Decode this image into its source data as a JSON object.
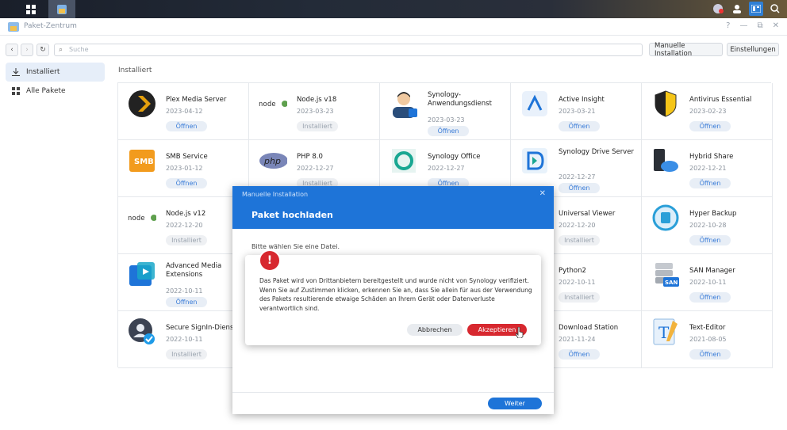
{
  "window": {
    "title": "Paket-Zentrum",
    "controls": [
      "?",
      "—",
      "⧉",
      "✕"
    ]
  },
  "toolbar": {
    "search_placeholder": "Suche",
    "manual_install": "Manuelle Installation",
    "settings": "Einstellungen"
  },
  "sidebar": {
    "items": [
      {
        "label": "Installiert",
        "icon": "download-icon",
        "active": true
      },
      {
        "label": "Alle Pakete",
        "icon": "grid-icon",
        "active": false
      }
    ]
  },
  "main": {
    "section_label": "Installiert",
    "packages": [
      {
        "name": "Plex Media Server",
        "date": "2023-04-12",
        "button": "Öffnen",
        "icon": "plex-icon"
      },
      {
        "name": "Node.js v18",
        "date": "2023-03-23",
        "button": "Installiert",
        "icon": "nodejs-icon"
      },
      {
        "name": "Synology-Anwendungsdienst",
        "date": "2023-03-23",
        "button": "Öffnen",
        "icon": "app-service-icon"
      },
      {
        "name": "Active Insight",
        "date": "2023-03-21",
        "button": "Öffnen",
        "icon": "active-insight-icon"
      },
      {
        "name": "Antivirus Essential",
        "date": "2023-02-23",
        "button": "Öffnen",
        "icon": "antivirus-icon"
      },
      {
        "name": "SMB Service",
        "date": "2023-01-12",
        "button": "Öffnen",
        "icon": "smb-icon"
      },
      {
        "name": "PHP 8.0",
        "date": "2022-12-27",
        "button": "Installiert",
        "icon": "php-icon"
      },
      {
        "name": "Synology Office",
        "date": "2022-12-27",
        "button": "Öffnen",
        "icon": "office-icon"
      },
      {
        "name": "Synology Drive Server",
        "date": "2022-12-27",
        "button": "Öffnen",
        "icon": "drive-icon"
      },
      {
        "name": "Hybrid Share",
        "date": "2022-12-21",
        "button": "Öffnen",
        "icon": "hybrid-share-icon"
      },
      {
        "name": "Node.js v12",
        "date": "2022-12-20",
        "button": "Installiert",
        "icon": "nodejs-icon"
      },
      {
        "name": "Universal Viewer",
        "date": "2022-12-20",
        "button": "Installiert",
        "icon": "viewer-icon"
      },
      {
        "name": "Hyper Backup",
        "date": "2022-10-28",
        "button": "Öffnen",
        "icon": "hyper-backup-icon"
      },
      {
        "name": "Advanced Media Extensions",
        "date": "2022-10-11",
        "button": "Öffnen",
        "icon": "media-extensions-icon"
      },
      {
        "name": "Python2",
        "date": "2022-10-11",
        "button": "Installiert",
        "icon": "python-icon"
      },
      {
        "name": "SAN Manager",
        "date": "2022-10-11",
        "button": "Öffnen",
        "icon": "san-icon"
      },
      {
        "name": "Secure SignIn-Diens",
        "date": "2022-10-11",
        "button": "Installiert",
        "icon": "secure-signin-icon"
      },
      {
        "name": "Download Station",
        "date": "2021-11-24",
        "button": "Öffnen",
        "icon": "download-station-icon"
      },
      {
        "name": "Text-Editor",
        "date": "2021-08-05",
        "button": "Öffnen",
        "icon": "text-editor-icon"
      }
    ]
  },
  "modal": {
    "small_title": "Manuelle Installation",
    "heading": "Paket hochladen",
    "prompt": "Bitte wählen Sie eine Datei.",
    "next": "Weiter"
  },
  "alert": {
    "message": "Das Paket wird von Drittanbietern bereitgestellt und wurde nicht von Synology verifiziert. Wenn Sie auf Zustimmen klicken, erkennen Sie an, dass Sie allein für aus der Verwendung des Pakets resultierende etwaige Schäden an Ihrem Gerät oder Datenverluste verantwortlich sind.",
    "cancel": "Abbrechen",
    "accept": "Akzeptieren"
  },
  "colors": {
    "accent": "#1e74d8",
    "danger": "#d7282f"
  }
}
